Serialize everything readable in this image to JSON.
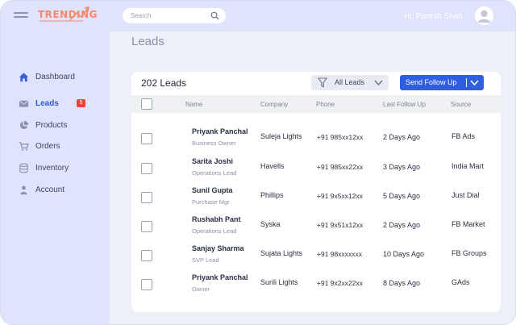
{
  "app": {
    "logo_text": "TRENDING",
    "greeting": "Hi, Paresh Shah"
  },
  "search": {
    "placeholder": "Search",
    "value": ""
  },
  "sidebar": {
    "items": [
      {
        "label": "Dashboard",
        "icon": "home-icon"
      },
      {
        "label": "Leads",
        "icon": "mail-icon",
        "active": true,
        "badge": "5"
      },
      {
        "label": "Products",
        "icon": "pie-chart-icon"
      },
      {
        "label": "Orders",
        "icon": "cart-icon"
      },
      {
        "label": "Inventory",
        "icon": "database-icon"
      },
      {
        "label": "Account",
        "icon": "user-icon"
      }
    ]
  },
  "main": {
    "title": "Leads",
    "count_label": "202 Leads",
    "filter_label": "All Leads",
    "followup_label": "Send Follow Up"
  },
  "table": {
    "columns": [
      "Name",
      "Company",
      "Phone",
      "Last Follow Up",
      "Source"
    ],
    "rows": [
      {
        "name": "Priyank Panchal",
        "role": "Business Owner",
        "company": "Suleja Lights",
        "phone": "+91 985xx12xx",
        "last": "2 Days Ago",
        "source": "FB Ads"
      },
      {
        "name": "Sarita Joshi",
        "role": "Operations Lead",
        "company": "Havells",
        "phone": "+91 985xx22xx",
        "last": "3 Days Ago",
        "source": "India Mart"
      },
      {
        "name": "Sunil Gupta",
        "role": "Purchase Mgr",
        "company": "Phillips",
        "phone": "+91 9x5xx12xx",
        "last": "5 Days Ago",
        "source": "Just Dial"
      },
      {
        "name": "Rushabh Pant",
        "role": "Operations Lead",
        "company": "Syska",
        "phone": "+91 9x51x12xx",
        "last": "2 Days Ago",
        "source": "FB Market"
      },
      {
        "name": "Sanjay Sharma",
        "role": "SVP Lead",
        "company": "Sujata Lights",
        "phone": "+91 98xxxxxxx",
        "last": "10 Days Ago",
        "source": "FB Groups"
      },
      {
        "name": "Priyank Panchal",
        "role": "Owner",
        "company": "Surili Lights",
        "phone": "+91 9x2xx22xx",
        "last": "8 Days Ago",
        "source": "GAds"
      }
    ]
  },
  "colors": {
    "accent": "#2f5fe0",
    "logo": "#f48a6c",
    "badge": "#e8443b",
    "sidebar_bg": "#dfe3fb"
  }
}
